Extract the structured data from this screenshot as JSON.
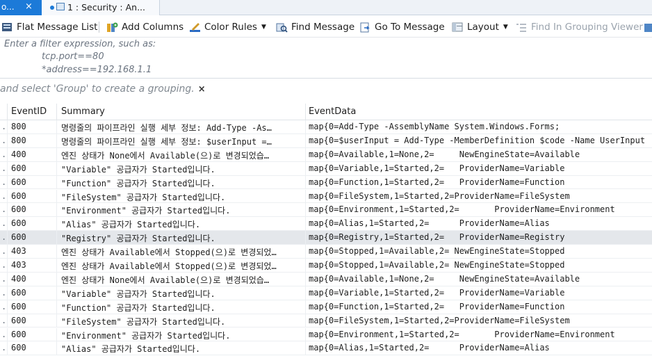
{
  "tabs": {
    "previous": {
      "label": "o...",
      "close": "×"
    },
    "active": {
      "label": "1 : Security : An..."
    }
  },
  "toolbar": {
    "flat_message_list": "Flat Message List",
    "add_columns": "Add Columns",
    "color_rules": "Color Rules",
    "find_message": "Find Message",
    "go_to_message": "Go To Message",
    "layout": "Layout",
    "find_in_grouping_viewer": "Find In Grouping Viewer",
    "caret": "▼"
  },
  "filter": {
    "line1": "Enter a filter expression, such as:",
    "line2": "tcp.port==80",
    "line3": "*address==192.168.1.1"
  },
  "group_hint": {
    "text": "and select 'Group' to create a grouping.",
    "close": "×"
  },
  "grid": {
    "columns": [
      "EventID",
      "Summary",
      "EventData"
    ],
    "row_prefix": "..",
    "rows": [
      {
        "event_id": "800",
        "summary": "명령줄의 파이프라인 실행 세부 정보: Add-Type -As…",
        "data": "map{0=Add-Type -AssemblyName System.Windows.Forms;"
      },
      {
        "event_id": "800",
        "summary": "명령줄의 파이프라인 실행 세부 정보: $userInput =…",
        "data": "map{0=$userInput = Add-Type -MemberDefinition $code -Name UserInput"
      },
      {
        "event_id": "400",
        "summary": "엔진 상태가 None에서 Available(으)로 변경되었습…",
        "data": "map{0=Available,1=None,2=     NewEngineState=Available"
      },
      {
        "event_id": "600",
        "summary": "\"Variable\" 공급자가 Started입니다.",
        "data": "map{0=Variable,1=Started,2=   ProviderName=Variable"
      },
      {
        "event_id": "600",
        "summary": "\"Function\" 공급자가 Started입니다.",
        "data": "map{0=Function,1=Started,2=   ProviderName=Function"
      },
      {
        "event_id": "600",
        "summary": "\"FileSystem\" 공급자가 Started입니다.",
        "data": "map{0=FileSystem,1=Started,2=ProviderName=FileSystem"
      },
      {
        "event_id": "600",
        "summary": "\"Environment\" 공급자가 Started입니다.",
        "data": "map{0=Environment,1=Started,2=       ProviderName=Environment"
      },
      {
        "event_id": "600",
        "summary": "\"Alias\" 공급자가 Started입니다.",
        "data": "map{0=Alias,1=Started,2=      ProviderName=Alias"
      },
      {
        "event_id": "600",
        "summary": "\"Registry\" 공급자가 Started입니다.",
        "data": "map{0=Registry,1=Started,2=   ProviderName=Registry",
        "selected": true
      },
      {
        "event_id": "403",
        "summary": "엔진 상태가 Available에서 Stopped(으)로 변경되었…",
        "data": "map{0=Stopped,1=Available,2= NewEngineState=Stopped"
      },
      {
        "event_id": "403",
        "summary": "엔진 상태가 Available에서 Stopped(으)로 변경되었…",
        "data": "map{0=Stopped,1=Available,2= NewEngineState=Stopped"
      },
      {
        "event_id": "400",
        "summary": "엔진 상태가 None에서 Available(으)로 변경되었습…",
        "data": "map{0=Available,1=None,2=     NewEngineState=Available"
      },
      {
        "event_id": "600",
        "summary": "\"Variable\" 공급자가 Started입니다.",
        "data": "map{0=Variable,1=Started,2=   ProviderName=Variable"
      },
      {
        "event_id": "600",
        "summary": "\"Function\" 공급자가 Started입니다.",
        "data": "map{0=Function,1=Started,2=   ProviderName=Function"
      },
      {
        "event_id": "600",
        "summary": "\"FileSystem\" 공급자가 Started입니다.",
        "data": "map{0=FileSystem,1=Started,2=ProviderName=FileSystem"
      },
      {
        "event_id": "600",
        "summary": "\"Environment\" 공급자가 Started입니다.",
        "data": "map{0=Environment,1=Started,2=       ProviderName=Environment"
      },
      {
        "event_id": "600",
        "summary": "\"Alias\" 공급자가 Started입니다.",
        "data": "map{0=Alias,1=Started,2=      ProviderName=Alias"
      }
    ]
  },
  "colors": {
    "accent": "#1c7ad8",
    "selected_row": "#e4e7eb"
  }
}
